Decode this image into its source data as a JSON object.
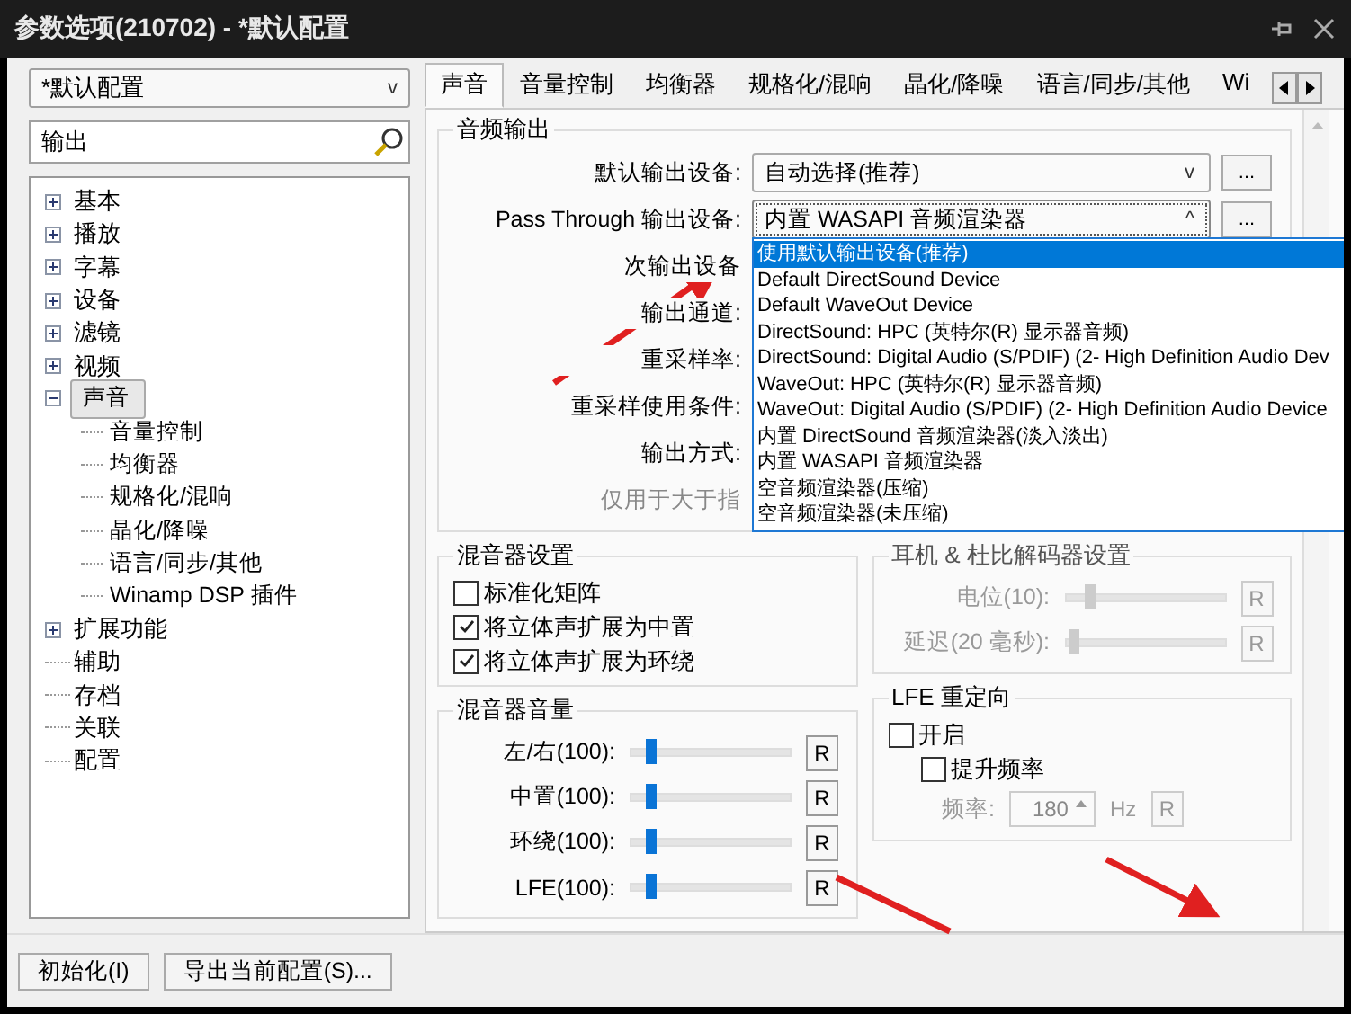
{
  "window": {
    "title": "参数选项(210702) - *默认配置"
  },
  "profile_select": {
    "value": "*默认配置",
    "caret": "v"
  },
  "search": {
    "value": "输出"
  },
  "tree": [
    {
      "label": "基本",
      "expanded": false,
      "selected": false
    },
    {
      "label": "播放",
      "expanded": false,
      "selected": false
    },
    {
      "label": "字幕",
      "expanded": false,
      "selected": false
    },
    {
      "label": "设备",
      "expanded": false,
      "selected": false
    },
    {
      "label": "滤镜",
      "expanded": false,
      "selected": false
    },
    {
      "label": "视频",
      "expanded": false,
      "selected": false
    },
    {
      "label": "声音",
      "expanded": true,
      "selected": true,
      "children": [
        {
          "label": "音量控制",
          "selected": false
        },
        {
          "label": "均衡器",
          "selected": false
        },
        {
          "label": "规格化/混响",
          "selected": false
        },
        {
          "label": "晶化/降噪",
          "selected": false
        },
        {
          "label": "语言/同步/其他",
          "selected": false
        },
        {
          "label": "Winamp DSP 插件",
          "selected": false
        }
      ]
    },
    {
      "label": "扩展功能",
      "expanded": false,
      "selected": false
    },
    {
      "label": "辅助",
      "selected": false
    },
    {
      "label": "存档",
      "selected": false
    },
    {
      "label": "关联",
      "selected": false
    },
    {
      "label": "配置",
      "selected": false
    }
  ],
  "tabs": [
    {
      "label": "声音",
      "selected": true
    },
    {
      "label": "音量控制",
      "selected": false
    },
    {
      "label": "均衡器",
      "selected": false
    },
    {
      "label": "规格化/混响",
      "selected": false
    },
    {
      "label": "晶化/降噪",
      "selected": false
    },
    {
      "label": "语言/同步/其他",
      "selected": false
    },
    {
      "label": "Wi",
      "selected": false
    }
  ],
  "audio_output": {
    "title": "音频输出",
    "rows": [
      {
        "kind": "select",
        "label": "默认输出设备:",
        "value": "自动选择(推荐)",
        "caret": "v",
        "more": "...",
        "open": false
      },
      {
        "kind": "select",
        "label": "Pass Through 输出设备:",
        "value": "内置 WASAPI 音频渲染器",
        "caret": "^",
        "more": "...",
        "open": true
      },
      {
        "kind": "label",
        "label": "次输出设备"
      },
      {
        "kind": "label",
        "label": "输出通道:"
      },
      {
        "kind": "label",
        "label": "重采样率:"
      },
      {
        "kind": "label",
        "label": "重采样使用条件:"
      },
      {
        "kind": "label",
        "label": "输出方式:"
      },
      {
        "kind": "note",
        "label": "仅用于大于指"
      }
    ],
    "dropdown": [
      {
        "label": "使用默认输出设备(推荐)",
        "selected": true
      },
      {
        "label": "Default DirectSound Device",
        "selected": false
      },
      {
        "label": "Default WaveOut Device",
        "selected": false
      },
      {
        "label": "DirectSound: HPC (英特尔(R) 显示器音频)",
        "selected": false
      },
      {
        "label": "DirectSound: Digital Audio (S/PDIF) (2- High Definition Audio Dev",
        "selected": false
      },
      {
        "label": "WaveOut: HPC (英特尔(R) 显示器音频)",
        "selected": false
      },
      {
        "label": "WaveOut: Digital Audio (S/PDIF) (2- High Definition Audio Device",
        "selected": false
      },
      {
        "label": "内置 DirectSound 音频渲染器(淡入淡出)",
        "selected": false
      },
      {
        "label": "内置 WASAPI 音频渲染器",
        "selected": false
      },
      {
        "label": "空音频渲染器(压缩)",
        "selected": false
      },
      {
        "label": "空音频渲染器(未压缩)",
        "selected": false
      }
    ]
  },
  "mixer_settings": {
    "title": "混音器设置",
    "options": [
      {
        "label": "标准化矩阵",
        "checked": false
      },
      {
        "label": "将立体声扩展为中置",
        "checked": true
      },
      {
        "label": "将立体声扩展为环绕",
        "checked": true
      }
    ]
  },
  "headphone": {
    "title": "耳机 & 杜比解码器设置",
    "disabled": true,
    "sliders": [
      {
        "label": "电位(10):",
        "level": 0.15,
        "reset": "R"
      },
      {
        "label": "延迟(20 毫秒):",
        "level": 0.05,
        "reset": "R"
      }
    ]
  },
  "mixer_volume": {
    "title": "混音器音量",
    "sliders": [
      {
        "label": "左/右(100):",
        "level": 0.12,
        "reset": "R"
      },
      {
        "label": "中置(100):",
        "level": 0.12,
        "reset": "R"
      },
      {
        "label": "环绕(100):",
        "level": 0.12,
        "reset": "R"
      },
      {
        "label": "LFE(100):",
        "level": 0.12,
        "reset": "R"
      }
    ]
  },
  "lfe": {
    "title": "LFE 重定向",
    "enable": {
      "label": "开启",
      "checked": false
    },
    "boost": {
      "label": "提升频率",
      "checked": false
    },
    "frequency": {
      "label": "频率:",
      "value": "180",
      "unit": "Hz",
      "reset": "R",
      "disabled": true
    }
  },
  "buttons": [
    "初始化(I)",
    "导出当前配置(S)..."
  ]
}
